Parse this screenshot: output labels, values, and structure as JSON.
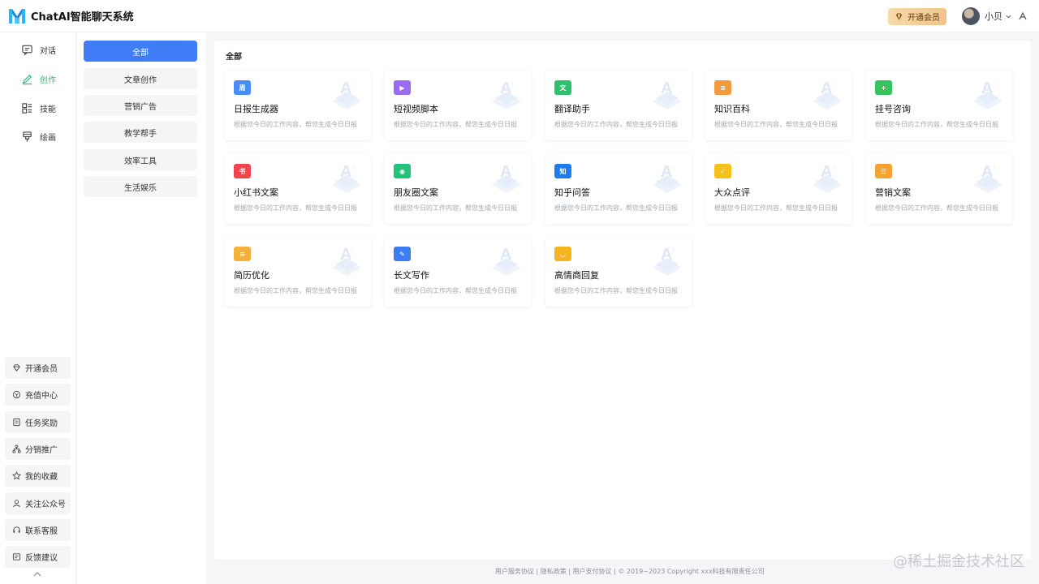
{
  "app": {
    "title": "ChatAI智能聊天系统"
  },
  "header": {
    "vip_label": "开通会员",
    "user_name": "小贝"
  },
  "nav": [
    {
      "label": "对话",
      "icon": "chat-icon"
    },
    {
      "label": "创作",
      "icon": "pen-icon",
      "active": true
    },
    {
      "label": "技能",
      "icon": "skills-icon"
    },
    {
      "label": "绘画",
      "icon": "paint-icon"
    }
  ],
  "side_buttons": [
    {
      "label": "开通会员",
      "icon": "diamond-icon"
    },
    {
      "label": "充值中心",
      "icon": "recharge-icon"
    },
    {
      "label": "任务奖励",
      "icon": "task-icon"
    },
    {
      "label": "分销推广",
      "icon": "share-icon"
    },
    {
      "label": "我的收藏",
      "icon": "star-icon"
    },
    {
      "label": "关注公众号",
      "icon": "user-icon"
    },
    {
      "label": "联系客服",
      "icon": "headset-icon"
    },
    {
      "label": "反馈建议",
      "icon": "feedback-icon"
    }
  ],
  "categories": [
    {
      "label": "全部",
      "active": true
    },
    {
      "label": "文章创作"
    },
    {
      "label": "营销广告"
    },
    {
      "label": "教学帮手"
    },
    {
      "label": "效率工具"
    },
    {
      "label": "生活娱乐"
    }
  ],
  "main": {
    "title": "全部",
    "cards": [
      {
        "title": "日报生成器",
        "desc": "根据您今日的工作内容，帮您生成今日日报",
        "icon": "calendar-icon",
        "color": "#4a8cf7",
        "glyph": "周"
      },
      {
        "title": "短视频脚本",
        "desc": "根据您今日的工作内容，帮您生成今日日报",
        "icon": "video-icon",
        "color": "#9a6cf2",
        "glyph": "▶"
      },
      {
        "title": "翻译助手",
        "desc": "根据您今日的工作内容，帮您生成今日日报",
        "icon": "translate-icon",
        "color": "#2fbf6f",
        "glyph": "文"
      },
      {
        "title": "知识百科",
        "desc": "根据您今日的工作内容，帮您生成今日日报",
        "icon": "book-icon",
        "color": "#f39a3c",
        "glyph": "≡"
      },
      {
        "title": "挂号咨询",
        "desc": "根据您今日的工作内容，帮您生成今日日报",
        "icon": "hospital-icon",
        "color": "#35c45d",
        "glyph": "+"
      },
      {
        "title": "小红书文案",
        "desc": "根据您今日的工作内容，帮您生成今日日报",
        "icon": "redbook-icon",
        "color": "#f0454f",
        "glyph": "书"
      },
      {
        "title": "朋友圈文案",
        "desc": "根据您今日的工作内容，帮您生成今日日报",
        "icon": "moments-icon",
        "color": "#22c27a",
        "glyph": "◉"
      },
      {
        "title": "知乎问答",
        "desc": "根据您今日的工作内容，帮您生成今日日报",
        "icon": "zhihu-icon",
        "color": "#1f7cf0",
        "glyph": "知"
      },
      {
        "title": "大众点评",
        "desc": "根据您今日的工作内容，帮您生成今日日报",
        "icon": "review-icon",
        "color": "#f5c21c",
        "glyph": "✓"
      },
      {
        "title": "营销文案",
        "desc": "根据您今日的工作内容，帮您生成今日日报",
        "icon": "marketing-icon",
        "color": "#f5a234",
        "glyph": "☰"
      },
      {
        "title": "简历优化",
        "desc": "根据您今日的工作内容，帮您生成今日日报",
        "icon": "resume-icon",
        "color": "#f4b23c",
        "glyph": "≡"
      },
      {
        "title": "长文写作",
        "desc": "根据您今日的工作内容，帮您生成今日日报",
        "icon": "write-icon",
        "color": "#3c7ef2",
        "glyph": "✎"
      },
      {
        "title": "高情商回复",
        "desc": "根据您今日的工作内容，帮您生成今日日报",
        "icon": "smile-icon",
        "color": "#f6b51e",
        "glyph": "◡"
      }
    ]
  },
  "footer": {
    "text": "用户服务协议 | 隐私政策 | 用户支付协议 | © 2019~2023 Copyright xxx科技有限责任公司"
  },
  "watermark": {
    "text": "@稀土掘金技术社区"
  }
}
